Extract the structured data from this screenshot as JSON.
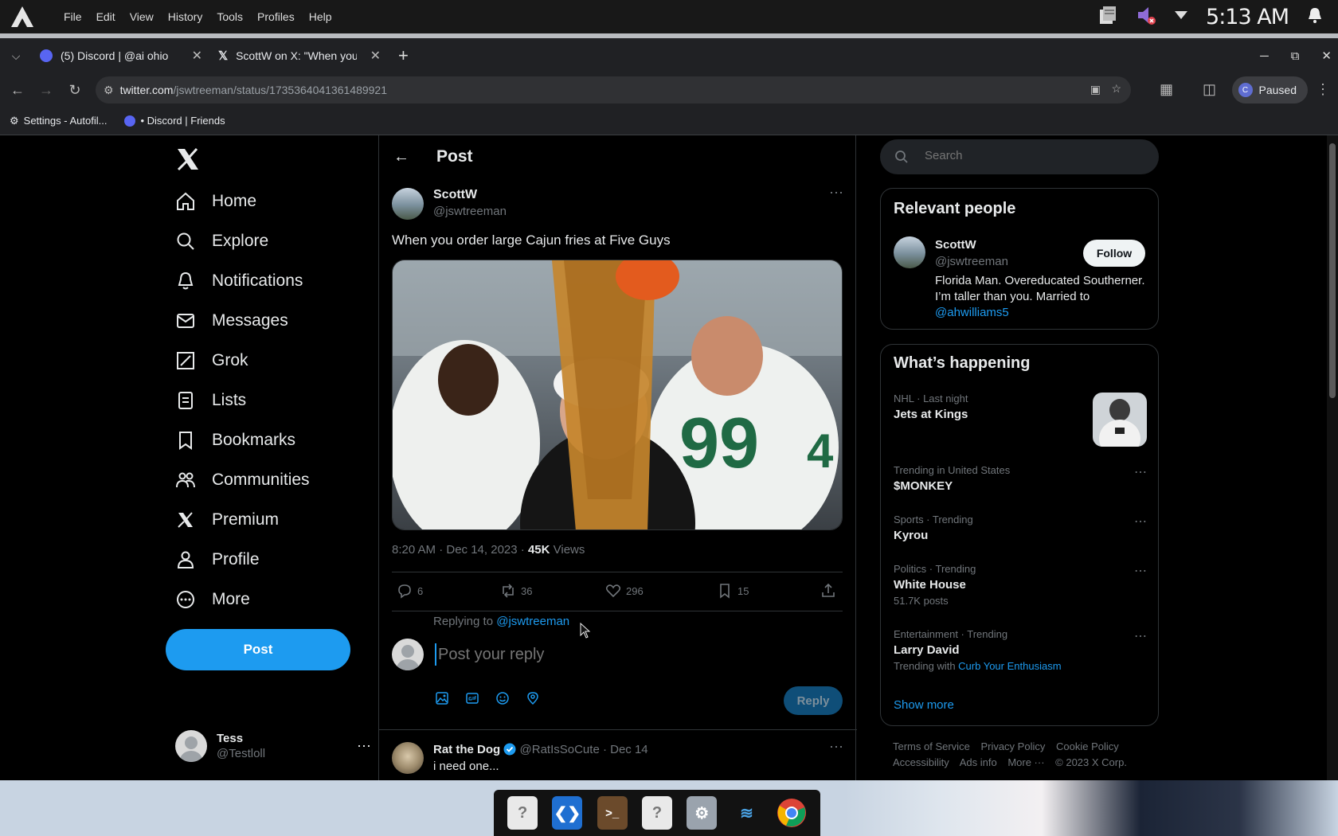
{
  "system": {
    "menu": [
      "File",
      "Edit",
      "View",
      "History",
      "Tools",
      "Profiles",
      "Help"
    ],
    "clock": "5:13 AM"
  },
  "browser": {
    "tabs": [
      {
        "label": "(5) Discord | @ai ohio"
      },
      {
        "label": "ScottW on X: \"When you o"
      }
    ],
    "url_host": "twitter.com",
    "url_path": "/jswtreeman/status/1735364041361489921",
    "profile_initial": "C",
    "profile_status": "Paused",
    "bookmarks": [
      "Settings - Autofil...",
      "• Discord | Friends"
    ]
  },
  "nav": {
    "items": [
      "Home",
      "Explore",
      "Notifications",
      "Messages",
      "Grok",
      "Lists",
      "Bookmarks",
      "Communities",
      "Premium",
      "Profile",
      "More"
    ],
    "post_label": "Post",
    "account_name": "Tess",
    "account_handle": "@Testloll"
  },
  "post": {
    "header_title": "Post",
    "author_name": "ScottW",
    "author_handle": "@jswtreeman",
    "text": "When you order large Cajun fries at Five Guys",
    "meta_time": "8:20 AM · Dec 14, 2023 · ",
    "views_count": "45K",
    "views_label": " Views",
    "replies": "6",
    "reposts": "36",
    "likes": "296",
    "bookmarks": "15",
    "replying_prefix": "Replying to ",
    "replying_to": "@jswtreeman",
    "reply_placeholder": "Post your reply",
    "reply_button": "Reply"
  },
  "reply_item": {
    "name": "Rat the Dog",
    "handle_meta": "@RatIsSoCute · Dec 14",
    "text": "i need one..."
  },
  "right": {
    "search_placeholder": "Search",
    "relevant_title": "Relevant people",
    "person_name": "ScottW",
    "person_handle": "@jswtreeman",
    "follow_label": "Follow",
    "bio": "Florida Man. Overeducated Southerner. I’m taller than you. Married to ",
    "bio_link": "@ahwilliams5",
    "happening_title": "What’s happening",
    "trends": [
      {
        "context": "NHL · Last night",
        "name": "Jets at Kings",
        "sub": ""
      },
      {
        "context": "Trending in United States",
        "name": "$MONKEY",
        "sub": ""
      },
      {
        "context": "Sports · Trending",
        "name": "Kyrou",
        "sub": ""
      },
      {
        "context": "Politics · Trending",
        "name": "White House",
        "sub": "51.7K posts"
      },
      {
        "context": "Entertainment · Trending",
        "name": "Larry David",
        "sub": "Trending with ",
        "sub_link": "Curb Your Enthusiasm"
      }
    ],
    "show_more": "Show more",
    "footer": [
      "Terms of Service",
      "Privacy Policy",
      "Cookie Policy",
      "Accessibility",
      "Ads info",
      "More ···",
      "© 2023 X Corp."
    ]
  },
  "colors": {
    "accent": "#1d9bf0",
    "text": "#e7e9ea",
    "muted": "#71767b",
    "border": "#2f3336"
  }
}
